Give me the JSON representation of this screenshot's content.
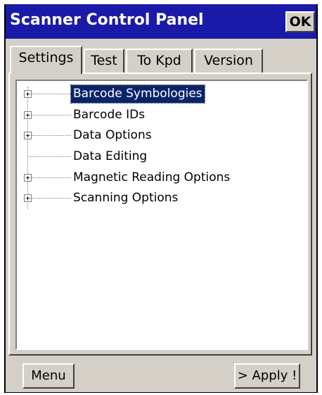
{
  "window": {
    "title": "Scanner Control Panel",
    "ok_label": "OK"
  },
  "tabs": [
    {
      "label": "Settings",
      "selected": true
    },
    {
      "label": "Test",
      "selected": false
    },
    {
      "label": "To Kpd",
      "selected": false
    },
    {
      "label": "Version",
      "selected": false
    }
  ],
  "tree": {
    "items": [
      {
        "label": "Barcode Symbologies",
        "expandable": true,
        "selected": true
      },
      {
        "label": "Barcode IDs",
        "expandable": true,
        "selected": false
      },
      {
        "label": "Data Options",
        "expandable": true,
        "selected": false
      },
      {
        "label": "Data Editing",
        "expandable": false,
        "selected": false
      },
      {
        "label": "Magnetic Reading Options",
        "expandable": true,
        "selected": false
      },
      {
        "label": "Scanning Options",
        "expandable": true,
        "selected": false
      }
    ],
    "expander_glyph": "+"
  },
  "buttons": {
    "menu_label": "Menu",
    "apply_label": "> Apply !"
  },
  "colors": {
    "titlebar": "#1a1aa8",
    "face": "#d4d0c8",
    "selection": "#0a246a"
  }
}
